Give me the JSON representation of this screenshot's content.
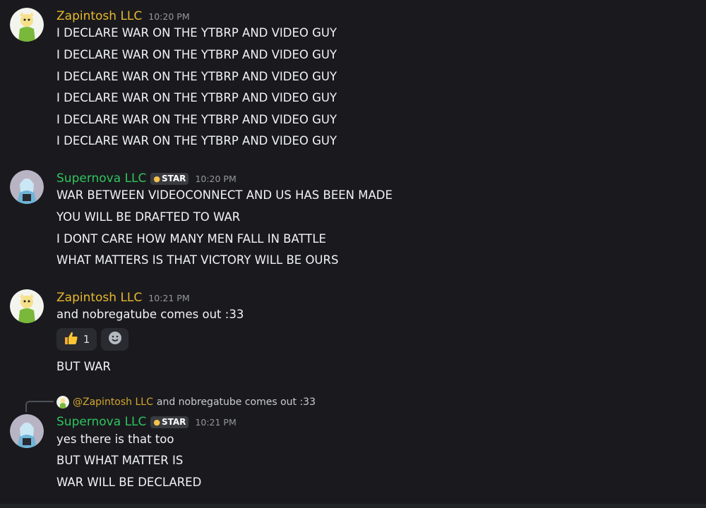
{
  "messages": [
    {
      "user": "Zapintosh LLC",
      "time": "10:20 PM",
      "lines": [
        "I DECLARE WAR ON THE YTBRP AND VIDEO GUY",
        "I DECLARE WAR ON THE YTBRP AND VIDEO GUY",
        "I DECLARE WAR ON THE YTBRP AND VIDEO GUY",
        "I DECLARE WAR ON THE YTBRP AND VIDEO GUY",
        "I DECLARE WAR ON THE YTBRP AND VIDEO GUY",
        "I DECLARE WAR ON THE YTBRP AND VIDEO GUY"
      ]
    },
    {
      "user": "Supernova LLC",
      "tag": "STAR",
      "time": "10:20 PM",
      "lines": [
        "WAR BETWEEN VIDEOCONNECT AND US HAS BEEN MADE",
        "YOU WILL BE DRAFTED TO WAR",
        "I DONT CARE HOW MANY MEN FALL IN BATTLE",
        "WHAT MATTERS IS THAT VICTORY WILL BE OURS"
      ]
    },
    {
      "user": "Zapintosh LLC",
      "time": "10:21 PM",
      "lines": [
        "and nobregatube comes out :33",
        "BUT WAR"
      ],
      "reaction": {
        "emoji": "thumbs-up-icon",
        "count": "1"
      }
    },
    {
      "reply_to": {
        "user": "@Zapintosh LLC",
        "text": "and nobregatube comes out :33"
      },
      "user": "Supernova LLC",
      "tag": "STAR",
      "time": "10:21 PM",
      "lines": [
        "yes there is that too",
        "BUT WHAT MATTER IS",
        "WAR WILL BE DECLARED"
      ]
    }
  ],
  "colors": {
    "background": "#1a1a1e",
    "zapintosh": "#e8b92c",
    "supernova": "#2fc45f",
    "text": "#f2f3f5",
    "timestamp": "#94979e"
  }
}
